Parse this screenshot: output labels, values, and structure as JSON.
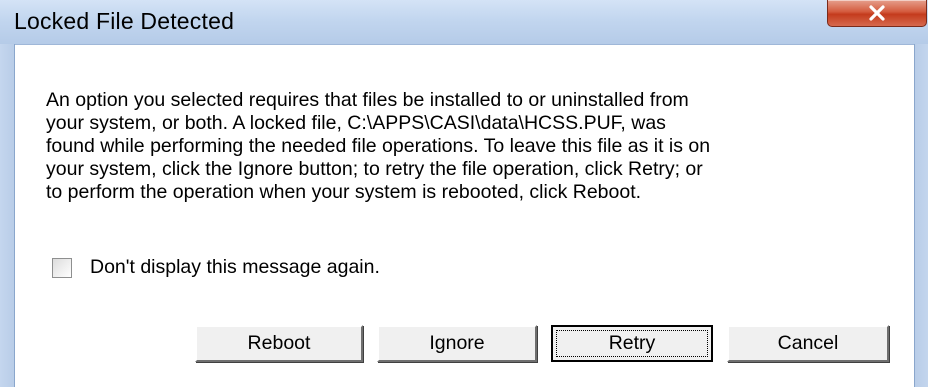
{
  "window": {
    "title": "Locked File Detected",
    "close_icon": "close-icon"
  },
  "message": {
    "lines": [
      "An option you selected requires that files be installed to or uninstalled from",
      "your system, or both. A locked file, C:\\APPS\\CASI\\data\\HCSS.PUF, was",
      "found while performing the needed file operations. To leave this file as it is on",
      "your system, click the Ignore button; to retry the file operation, click Retry; or",
      "to perform the operation when your system is rebooted, click Reboot."
    ]
  },
  "checkbox": {
    "label": "Don't display this message again.",
    "checked": false
  },
  "buttons": {
    "reboot": "Reboot",
    "ignore": "Ignore",
    "retry": "Retry",
    "cancel": "Cancel"
  },
  "colors": {
    "titlebar": "#c2d6ef",
    "close_button": "#c43b1d",
    "button_face": "#f0f0f0"
  }
}
